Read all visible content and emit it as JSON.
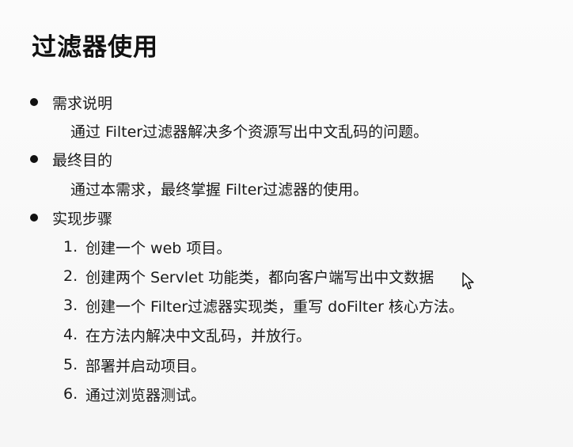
{
  "title": "过滤器使用",
  "sections": [
    {
      "heading": "需求说明",
      "content": "通过 Filter过滤器解决多个资源写出中文乱码的问题。"
    },
    {
      "heading": "最终目的",
      "content": "通过本需求，最终掌握 Filter过滤器的使用。"
    },
    {
      "heading": "实现步骤",
      "steps": [
        {
          "num": "1.",
          "text": "创建一个 web 项目。"
        },
        {
          "num": "2.",
          "text": "创建两个 Servlet 功能类，都向客户端写出中文数据"
        },
        {
          "num": "3.",
          "text": "创建一个 Filter过滤器实现类，重写 doFilter 核心方法。"
        },
        {
          "num": "4.",
          "text": "在方法内解决中文乱码，并放行。"
        },
        {
          "num": "5.",
          "text": "部署并启动项目。"
        },
        {
          "num": "6.",
          "text": "通过浏览器测试。"
        }
      ]
    }
  ],
  "icons": {
    "bullet": "bullet-dot-icon",
    "cursor": "mouse-pointer-icon"
  }
}
